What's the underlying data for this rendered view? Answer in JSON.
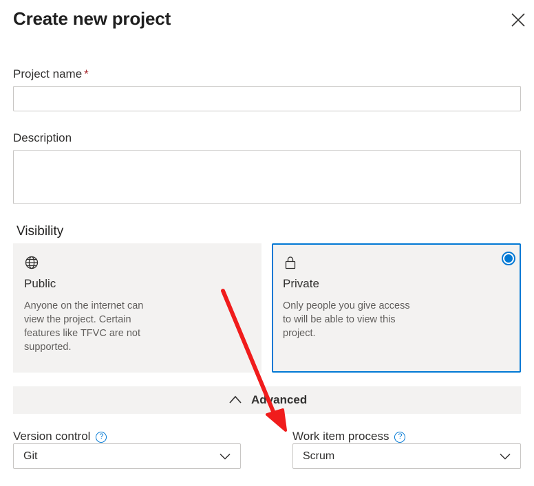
{
  "dialog": {
    "title": "Create new project",
    "close_icon": "close-icon"
  },
  "project_name": {
    "label": "Project name",
    "required_marker": "*",
    "value": "",
    "placeholder": ""
  },
  "description": {
    "label": "Description",
    "value": "",
    "placeholder": ""
  },
  "visibility": {
    "label": "Visibility",
    "selected": "private",
    "options": [
      {
        "id": "public",
        "icon": "globe-icon",
        "name": "Public",
        "description": "Anyone on the internet can view the project. Certain features like TFVC are not supported."
      },
      {
        "id": "private",
        "icon": "lock-icon",
        "name": "Private",
        "description": "Only people you give access to will be able to view this project."
      }
    ]
  },
  "advanced": {
    "label": "Advanced",
    "expanded": true,
    "version_control": {
      "label": "Version control",
      "help_glyph": "?",
      "value": "Git"
    },
    "work_item_process": {
      "label": "Work item process",
      "help_glyph": "?",
      "value": "Scrum"
    }
  },
  "colors": {
    "accent": "#0078d4",
    "card_bg": "#f3f2f1",
    "required": "#a4262c",
    "annotation_arrow": "#f01c1c"
  }
}
